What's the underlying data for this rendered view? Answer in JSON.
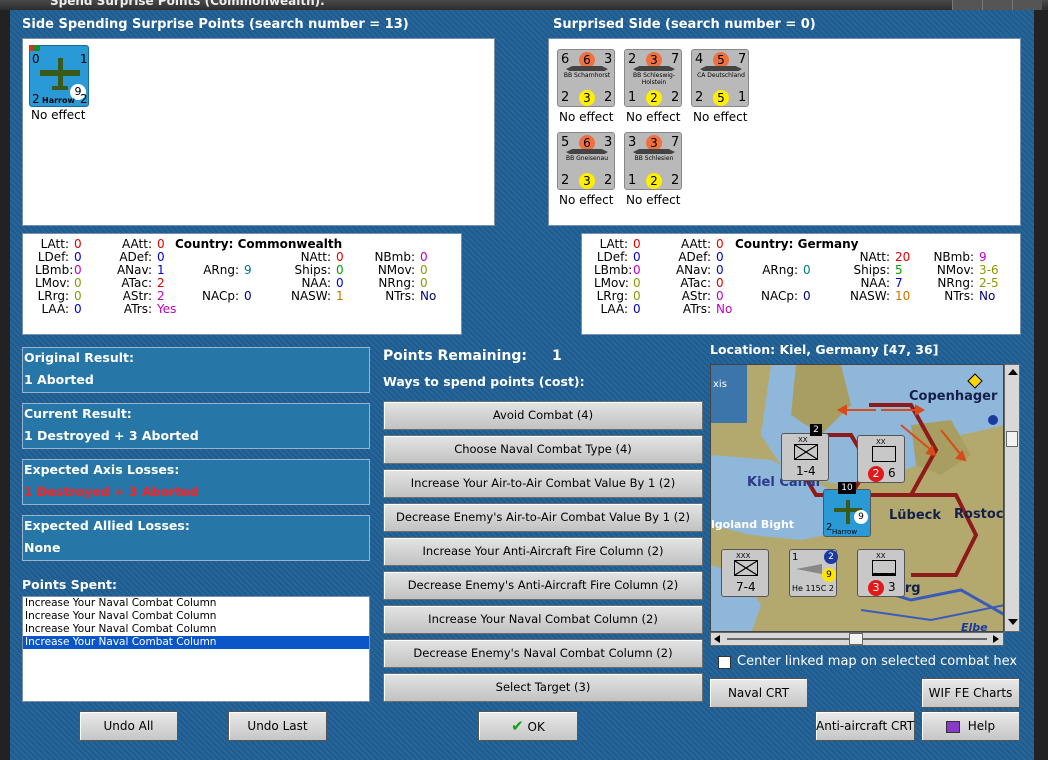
{
  "window": {
    "title": "Spend Surprise Points (Commonwealth)."
  },
  "spending": {
    "header": "Side Spending Surprise Points (search number = 13)",
    "unit": {
      "name": "Harrow",
      "att": "0",
      "top_right": "1",
      "bl": "2",
      "br": "2",
      "circle": "9",
      "effect": "No effect"
    }
  },
  "surprised": {
    "header": "Surprised Side (search number = 0)",
    "units": [
      {
        "name": "BB Scharnhorst",
        "tl": "6",
        "tc": "6",
        "tr": "3",
        "bl": "2",
        "bc": "3",
        "br": "2",
        "effect": "No effect"
      },
      {
        "name": "BB Schleswig-Holstein",
        "tl": "2",
        "tc": "3",
        "tr": "7",
        "bl": "1",
        "bc": "2",
        "br": "2",
        "effect": "No effect"
      },
      {
        "name": "CA Deutschland",
        "tl": "4",
        "tc": "5",
        "tr": "7",
        "bl": "2",
        "bc": "5",
        "br": "1",
        "effect": "No effect"
      },
      {
        "name": "BB Gneisenau",
        "tl": "5",
        "tc": "6",
        "tr": "3",
        "bl": "2",
        "bc": "3",
        "br": "2",
        "effect": "No effect"
      },
      {
        "name": "BB Schlesien",
        "tl": "3",
        "tc": "3",
        "tr": "7",
        "bl": "1",
        "bc": "2",
        "br": "2",
        "effect": "No effect"
      }
    ]
  },
  "stats_left": {
    "country": "Country: Commonwealth",
    "items": [
      {
        "k": "LAtt:",
        "v": "0"
      },
      {
        "k": "LDef:",
        "v": "0"
      },
      {
        "k": "LBmb:",
        "v": "0"
      },
      {
        "k": "LMov:",
        "v": "0"
      },
      {
        "k": "LRrg:",
        "v": "0"
      },
      {
        "k": "LAA:",
        "v": "0"
      },
      {
        "k": "AAtt:",
        "v": "0"
      },
      {
        "k": "ADef:",
        "v": "0"
      },
      {
        "k": "ANav:",
        "v": "1"
      },
      {
        "k": "ATac:",
        "v": "2"
      },
      {
        "k": "AStr:",
        "v": "2"
      },
      {
        "k": "ATrs:",
        "v": "Yes"
      },
      {
        "k": "ARng:",
        "v": "9"
      },
      {
        "k": "NACp:",
        "v": "0"
      },
      {
        "k": "NAtt:",
        "v": "0"
      },
      {
        "k": "Ships:",
        "v": "0"
      },
      {
        "k": "NAA:",
        "v": "0"
      },
      {
        "k": "NASW:",
        "v": "1"
      },
      {
        "k": "NBmb:",
        "v": "0"
      },
      {
        "k": "NMov:",
        "v": "0"
      },
      {
        "k": "NRng:",
        "v": "0"
      },
      {
        "k": "NTrs:",
        "v": "No"
      }
    ]
  },
  "stats_right": {
    "country": "Country: Germany",
    "items": [
      {
        "k": "LAtt:",
        "v": "0"
      },
      {
        "k": "LDef:",
        "v": "0"
      },
      {
        "k": "LBmb:",
        "v": "0"
      },
      {
        "k": "LMov:",
        "v": "0"
      },
      {
        "k": "LRrg:",
        "v": "0"
      },
      {
        "k": "LAA:",
        "v": "0"
      },
      {
        "k": "AAtt:",
        "v": "0"
      },
      {
        "k": "ADef:",
        "v": "0"
      },
      {
        "k": "ANav:",
        "v": "0"
      },
      {
        "k": "ATac:",
        "v": "0"
      },
      {
        "k": "AStr:",
        "v": "0"
      },
      {
        "k": "ATrs:",
        "v": "No"
      },
      {
        "k": "ARng:",
        "v": "0"
      },
      {
        "k": "NACp:",
        "v": "0"
      },
      {
        "k": "NAtt:",
        "v": "20"
      },
      {
        "k": "Ships:",
        "v": "5"
      },
      {
        "k": "NAA:",
        "v": "7"
      },
      {
        "k": "NASW:",
        "v": "10"
      },
      {
        "k": "NBmb:",
        "v": "9"
      },
      {
        "k": "NMov:",
        "v": "3-6"
      },
      {
        "k": "NRng:",
        "v": "2-5"
      },
      {
        "k": "NTrs:",
        "v": "No"
      }
    ]
  },
  "results": [
    {
      "label": "Original Result:",
      "value": "1 Aborted",
      "red": false
    },
    {
      "label": "Current Result:",
      "value": "1 Destroyed + 3 Aborted",
      "red": false
    },
    {
      "label": "Expected Axis Losses:",
      "value": "1 Destroyed + 3 Aborted",
      "red": true
    },
    {
      "label": "Expected Allied Losses:",
      "value": "None",
      "red": false
    }
  ],
  "points_spent": {
    "label": "Points Spent:",
    "items": [
      "Increase Your Naval Combat Column",
      "Increase Your Naval Combat Column",
      "Increase Your Naval Combat Column",
      "Increase Your Naval Combat Column"
    ],
    "selected_index": 3
  },
  "points_remaining": {
    "label": "Points Remaining:",
    "value": "1"
  },
  "ways_label": "Ways to spend points (cost):",
  "ways": [
    "Avoid Combat (4)",
    "Choose Naval Combat Type (4)",
    "Increase Your Air-to-Air Combat Value By 1 (2)",
    "Decrease Enemy's Air-to-Air Combat Value By 1 (2)",
    "Increase Your Anti-Aircraft Fire Column (2)",
    "Decrease Enemy's Anti-Aircraft Fire Column (2)",
    "Increase Your Naval Combat Column (2)",
    "Decrease Enemy's Naval Combat Column (2)",
    "Select Target (3)"
  ],
  "location": "Location: Kiel, Germany [47, 36]",
  "map": {
    "labels": {
      "copenhagen": "Copenhager",
      "kiel": "Kiel Canal",
      "lubeck": "Lübeck",
      "rostock": "Rostoc",
      "heligoland": "lgoland Bight",
      "hamburg": "nburg",
      "elbe": "Elbe",
      "axis": "xis"
    },
    "counters": [
      {
        "id": "inf",
        "top": "XX",
        "bottom": "1-4",
        "side": "3rd Inf Bde",
        "badge": "2"
      },
      {
        "id": "para",
        "top": "XX",
        "bottom": "6",
        "side": "7 Flg",
        "circle": "2"
      },
      {
        "id": "harrow",
        "top": "10",
        "bottom": "2",
        "side": "Harrow",
        "circle": "9"
      },
      {
        "id": "mech",
        "top": "XXX",
        "bottom": "7-4",
        "side": "X Korps"
      },
      {
        "id": "he115",
        "top": "1",
        "bottom": "He 115C 2",
        "side": "",
        "circle": "9",
        "badge": "2"
      },
      {
        "id": "mtn",
        "top": "XX",
        "bottom": "3",
        "side": "XIII",
        "circle": "3"
      }
    ]
  },
  "center_checkbox": {
    "label": "Center linked map on selected combat hex",
    "checked": false
  },
  "buttons": {
    "undo_all": "Undo All",
    "undo_last": "Undo Last",
    "ok": "OK",
    "naval_crt": "Naval CRT",
    "wif_fe": "WIF FE Charts",
    "aa_crt": "Anti-aircraft CRT",
    "help": "Help"
  },
  "colors": {
    "background": "#1f5f95",
    "result_box": "#2677a8",
    "selected": "#0a56c8",
    "loss_red": "#ff2020"
  }
}
